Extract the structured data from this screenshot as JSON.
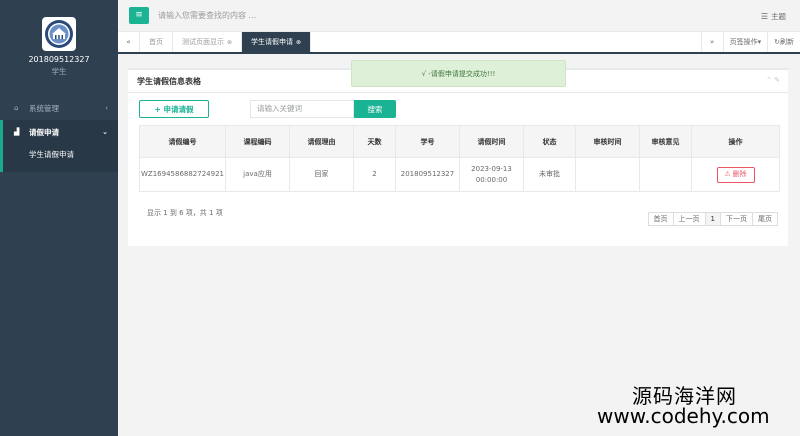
{
  "sidebar": {
    "profile": {
      "name": "201809512327",
      "role": "学生"
    },
    "items": [
      {
        "label": "系统管理",
        "icon": "home-icon"
      },
      {
        "label": "请假申请",
        "icon": "bar-chart-icon",
        "children": [
          {
            "label": "学生请假申请"
          }
        ]
      }
    ]
  },
  "topbar": {
    "menu_icon": "hamburger-icon",
    "search_placeholder": "请输入您需要查找的内容 ...",
    "theme_label": "主题"
  },
  "tabs": {
    "items": [
      {
        "label": "首页"
      },
      {
        "label": "测试页面显示"
      },
      {
        "label": "学生请假申请"
      }
    ],
    "page_ops": "页签操作",
    "refresh": "刷新"
  },
  "panel": {
    "title": "学生请假信息表格",
    "add_button": "申请请假",
    "keyword_placeholder": "请输入关键词",
    "search_button": "搜索"
  },
  "table": {
    "headers": [
      "请假编号",
      "课程编码",
      "请假理由",
      "天数",
      "学号",
      "请假时间",
      "状态",
      "审核时间",
      "审核意见",
      "操作"
    ],
    "rows": [
      {
        "id": "WZ1694586882724921",
        "course": "java应用",
        "reason": "回家",
        "days": "2",
        "student_no": "201809512327",
        "date": "2023-09-13",
        "time": "00:00:00",
        "status": "未审批",
        "review_time": "",
        "review_opinion": "",
        "delete_label": "删除"
      }
    ]
  },
  "pagination": {
    "info": "显示 1 到 6 项，共 1 项",
    "first": "首页",
    "prev": "上一页",
    "current": "1",
    "next": "下一页",
    "last": "尾页"
  },
  "toast": {
    "message": "√ -请假申请提交成功!!!"
  },
  "watermark": {
    "line1": "源码海洋网",
    "line2": "www.codehy.com"
  },
  "colors": {
    "sidebar_bg": "#2f4050",
    "accent": "#1ab394",
    "danger": "#ed5565",
    "toast_bg": "#dff0d8"
  }
}
